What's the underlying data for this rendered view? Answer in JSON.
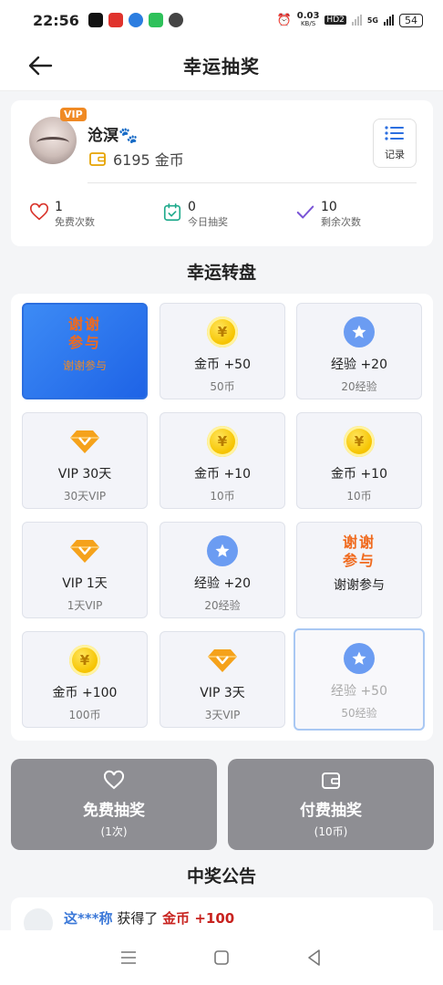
{
  "status": {
    "time": "22:56",
    "speed_top": "0.03",
    "speed_unit": "KB/S",
    "hd": "HD2",
    "net": "5G",
    "battery": "54"
  },
  "header": {
    "title": "幸运抽奖"
  },
  "user": {
    "vip_tag": "VIP",
    "name": "沧溟🐾",
    "coins": "6195 金币",
    "record_label": "记录"
  },
  "stats": [
    {
      "value": "1",
      "label": "免费次数"
    },
    {
      "value": "0",
      "label": "今日抽奖"
    },
    {
      "value": "10",
      "label": "剩余次数"
    }
  ],
  "wheel": {
    "title": "幸运转盘",
    "prizes": [
      {
        "type": "thanks",
        "art": "谢谢\n参与",
        "sub": "谢谢参与",
        "state": "active"
      },
      {
        "type": "coin",
        "name": "金币 +50",
        "sub": "50币"
      },
      {
        "type": "exp",
        "name": "经验 +20",
        "sub": "20经验"
      },
      {
        "type": "vip",
        "name": "VIP 30天",
        "sub": "30天VIP"
      },
      {
        "type": "coin",
        "name": "金币 +10",
        "sub": "10币"
      },
      {
        "type": "coin",
        "name": "金币 +10",
        "sub": "10币"
      },
      {
        "type": "vip",
        "name": "VIP 1天",
        "sub": "1天VIP"
      },
      {
        "type": "exp",
        "name": "经验 +20",
        "sub": "20经验"
      },
      {
        "type": "thanks",
        "art": "谢谢\n参与",
        "name": "谢谢参与"
      },
      {
        "type": "coin",
        "name": "金币 +100",
        "sub": "100币"
      },
      {
        "type": "vip",
        "name": "VIP 3天",
        "sub": "3天VIP"
      },
      {
        "type": "exp",
        "name": "经验 +50",
        "sub": "50经验",
        "state": "faded"
      }
    ]
  },
  "actions": {
    "free": {
      "label": "免费抽奖",
      "sub": "(1次)"
    },
    "paid": {
      "label": "付费抽奖",
      "sub": "(10币)"
    }
  },
  "announcement": {
    "title": "中奖公告",
    "items": [
      {
        "user": "这***称",
        "verb": " 获得了 ",
        "prize": "金币 +100"
      }
    ]
  },
  "colors": {
    "accent_blue": "#1e63e6",
    "thanks_orange": "#f06a1e",
    "vip_orange": "#f08a24",
    "button_gray": "#8e8e93"
  }
}
